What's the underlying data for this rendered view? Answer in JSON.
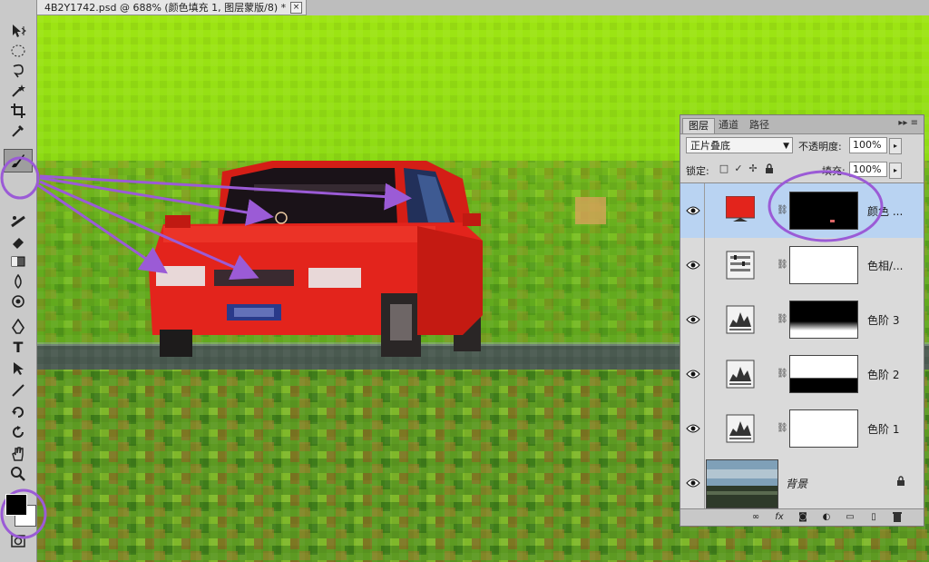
{
  "document": {
    "tab_title": "4B2Y1742.psd @ 688% (颜色填充 1, 图层蒙版/8) *",
    "close_glyph": "×"
  },
  "tools": [
    {
      "name": "move-tool",
      "icon": "move-icon",
      "glyph": "▸✥"
    },
    {
      "name": "marquee-tool",
      "icon": "elliptical-marquee-icon",
      "glyph": "◯"
    },
    {
      "name": "lasso-tool",
      "icon": "lasso-icon",
      "glyph": "ℒ"
    },
    {
      "name": "quick-select-tool",
      "icon": "magic-wand-icon",
      "glyph": "✶"
    },
    {
      "name": "crop-tool",
      "icon": "crop-icon",
      "glyph": "⌗"
    },
    {
      "name": "eyedropper-tool",
      "icon": "eyedropper-icon",
      "glyph": "✎"
    },
    {
      "name": "healing-tool",
      "icon": "bandage-icon",
      "glyph": "✚"
    },
    {
      "name": "brush-tool",
      "icon": "brush-icon",
      "glyph": "🖌"
    },
    {
      "name": "clone-stamp-tool",
      "icon": "stamp-icon",
      "glyph": "⚲"
    },
    {
      "name": "history-brush-tool",
      "icon": "history-brush-icon",
      "glyph": "↺"
    },
    {
      "name": "eraser-tool",
      "icon": "eraser-icon",
      "glyph": "▱"
    },
    {
      "name": "gradient-tool",
      "icon": "gradient-icon",
      "glyph": "▤"
    },
    {
      "name": "blur-tool",
      "icon": "blur-drop-icon",
      "glyph": "💧"
    },
    {
      "name": "dodge-tool",
      "icon": "dodge-icon",
      "glyph": "◔"
    },
    {
      "name": "pen-tool",
      "icon": "pen-icon",
      "glyph": "✒"
    },
    {
      "name": "type-tool",
      "icon": "type-icon",
      "glyph": "T"
    },
    {
      "name": "path-select-tool",
      "icon": "path-select-icon",
      "glyph": "➤"
    },
    {
      "name": "line-tool",
      "icon": "line-icon",
      "glyph": "╱"
    },
    {
      "name": "3d-rotate-tool",
      "icon": "rotate-3d-icon",
      "glyph": "⟲"
    },
    {
      "name": "3d-orbit-tool",
      "icon": "orbit-icon",
      "glyph": "⟳"
    },
    {
      "name": "hand-tool",
      "icon": "hand-icon",
      "glyph": "✋"
    },
    {
      "name": "zoom-tool",
      "icon": "zoom-icon",
      "glyph": "🔍"
    },
    {
      "name": "quick-mask-tool",
      "icon": "quick-mask-icon",
      "glyph": "▣"
    }
  ],
  "colors": {
    "foreground": "#000000",
    "background": "#ffffff",
    "annotation": "#9b5bd6",
    "selected_layer": "#b9d3f2",
    "fill_layer_color": "#e3241c"
  },
  "layers_panel": {
    "tabs": [
      "图层",
      "通道",
      "路径"
    ],
    "menu_glyph": "▸▸ ≡",
    "blend_mode": "正片叠底",
    "opacity_label": "不透明度:",
    "opacity_value": "100%",
    "lock_label": "锁定:",
    "lock_icons": [
      "□",
      "✓",
      "✢",
      "🔒"
    ],
    "fill_label": "填充:",
    "fill_value": "100%",
    "layers": [
      {
        "name": "颜色 ...",
        "type": "color-fill",
        "selected": true
      },
      {
        "name": "色相/...",
        "type": "hue-saturation",
        "selected": false
      },
      {
        "name": "色阶 3",
        "type": "levels",
        "selected": false
      },
      {
        "name": "色阶 2",
        "type": "levels",
        "selected": false
      },
      {
        "name": "色阶 1",
        "type": "levels",
        "selected": false
      },
      {
        "name": "背景",
        "type": "background",
        "selected": false
      }
    ],
    "footer_icons": [
      "link-layers-icon",
      "fx-icon",
      "add-mask-icon",
      "adjustment-icon",
      "group-icon",
      "new-layer-icon",
      "trash-icon"
    ],
    "footer_glyphs": [
      "∞",
      "fx",
      "◙",
      "◐",
      "▭",
      "▯",
      "🗑"
    ]
  }
}
